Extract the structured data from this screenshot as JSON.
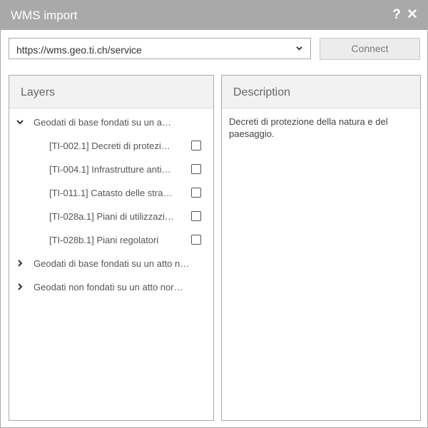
{
  "window": {
    "title": "WMS import"
  },
  "url_select": {
    "value": "https://wms.geo.ti.ch/service"
  },
  "connect_label": "Connect",
  "layers_panel": {
    "title": "Layers",
    "groups": [
      {
        "label": "Geodati di base fondati su un a…",
        "expanded": true,
        "items": [
          {
            "label": "[TI-002.1] Decreti di protezi…",
            "checked": false
          },
          {
            "label": "[TI-004.1] Infrastrutture anti…",
            "checked": false
          },
          {
            "label": "[TI-011.1] Catasto delle stra…",
            "checked": false
          },
          {
            "label": "[TI-028a.1] Piani di utilizzazi…",
            "checked": false
          },
          {
            "label": "[TI-028b.1] Piani regolatori",
            "checked": false
          }
        ]
      },
      {
        "label": "Geodati di base fondati su un atto n…",
        "expanded": false
      },
      {
        "label": "Geodati non fondati su un atto nor…",
        "expanded": false
      }
    ]
  },
  "description_panel": {
    "title": "Description",
    "text": "Decreti di protezione della natura e del paesaggio."
  },
  "colors": {
    "titlebar": "#a9a9a9",
    "border": "#a9a9a9",
    "panel_header": "#f2f2f2"
  }
}
